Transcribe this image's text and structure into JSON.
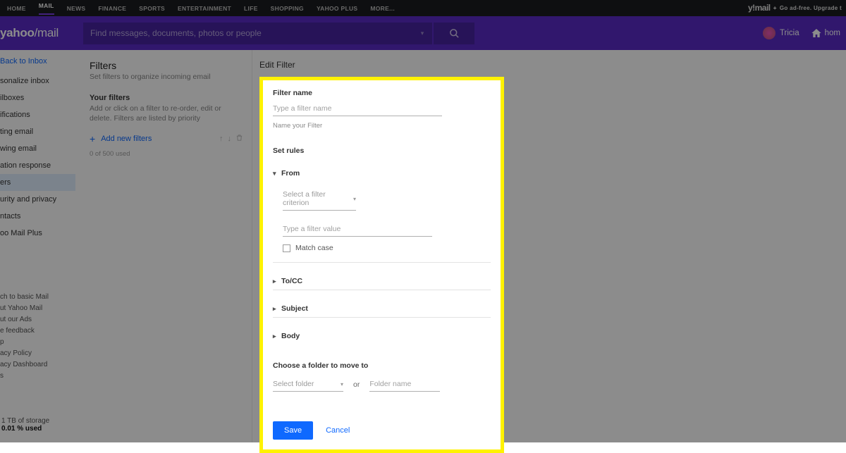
{
  "topnav": {
    "items": [
      "HOME",
      "MAIL",
      "NEWS",
      "FINANCE",
      "SPORTS",
      "ENTERTAINMENT",
      "LIFE",
      "SHOPPING",
      "YAHOO PLUS",
      "MORE..."
    ],
    "brand": "y!mail",
    "brand_plus": "+",
    "upsell": "Go ad-free. Upgrade t"
  },
  "header": {
    "logo_a": "yahoo",
    "logo_b": "/mail",
    "search_placeholder": "Find messages, documents, photos or people",
    "user_name": "Tricia",
    "home_label": "hom"
  },
  "sidebar": {
    "back": "Back to Inbox",
    "items": [
      "sonalize inbox",
      "ilboxes",
      "ifications",
      "ting email",
      "wing email",
      "ation response",
      "ers",
      "urity and privacy",
      "ntacts",
      "oo Mail Plus"
    ],
    "active_index": 6,
    "footer": [
      "ch to basic Mail",
      "ut Yahoo Mail",
      "ut our Ads",
      "e feedback",
      "p",
      "acy Policy",
      "acy Dashboard",
      "s"
    ],
    "storage_line": "1 TB of storage",
    "storage_used": "0.01 % used"
  },
  "filters": {
    "heading": "Filters",
    "sub": "Set filters to organize incoming email",
    "yours": "Your filters",
    "desc": "Add or click on a filter to re-order, edit or delete. Filters are listed by priority",
    "add": "Add new filters",
    "counter": "0 of 500 used"
  },
  "editor": {
    "title": "Edit Filter",
    "name_label": "Filter name",
    "name_placeholder": "Type a filter name",
    "name_hint": "Name your Filter",
    "rules_label": "Set rules",
    "rule_from": "From",
    "criterion_placeholder": "Select a filter criterion",
    "value_placeholder": "Type a filter value",
    "match_case": "Match case",
    "rule_tocc": "To/CC",
    "rule_subject": "Subject",
    "rule_body": "Body",
    "folder_label": "Choose a folder to move to",
    "select_folder": "Select folder",
    "or": "or",
    "folder_placeholder": "Folder name",
    "save": "Save",
    "cancel": "Cancel"
  }
}
